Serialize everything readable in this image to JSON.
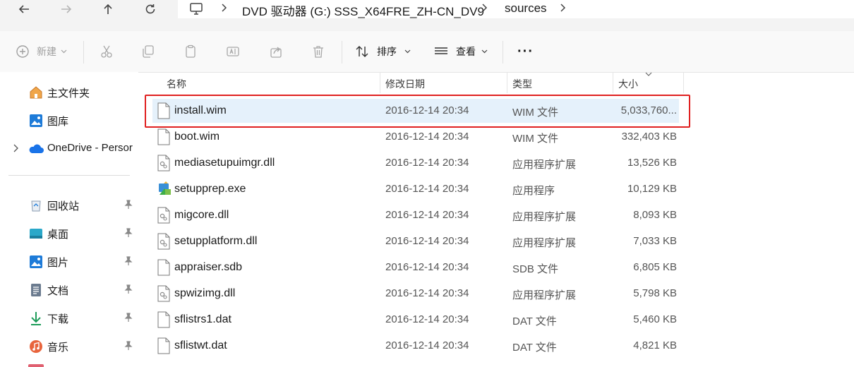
{
  "address": {
    "crumbs": [
      "DVD 驱动器 (G:) SSS_X64FRE_ZH-CN_DV9",
      "sources"
    ]
  },
  "toolbar": {
    "new_label": "新建",
    "sort_label": "排序",
    "view_label": "查看",
    "more_label": "···"
  },
  "sidebar": {
    "items": [
      {
        "label": "主文件夹"
      },
      {
        "label": "图库"
      },
      {
        "label": "OneDrive - Persor"
      },
      {
        "label": "回收站"
      },
      {
        "label": "桌面"
      },
      {
        "label": "图片"
      },
      {
        "label": "文档"
      },
      {
        "label": "下载"
      },
      {
        "label": "音乐"
      }
    ]
  },
  "columns": {
    "name": "名称",
    "date": "修改日期",
    "type": "类型",
    "size": "大小"
  },
  "files": [
    {
      "name": "install.wim",
      "date": "2016-12-14 20:34",
      "type": "WIM 文件",
      "size": "5,033,760...",
      "icon": "document-icon",
      "selected": true
    },
    {
      "name": "boot.wim",
      "date": "2016-12-14 20:34",
      "type": "WIM 文件",
      "size": "332,403 KB",
      "icon": "document-icon"
    },
    {
      "name": "mediasetupuimgr.dll",
      "date": "2016-12-14 20:34",
      "type": "应用程序扩展",
      "size": "13,526 KB",
      "icon": "dll-icon"
    },
    {
      "name": "setupprep.exe",
      "date": "2016-12-14 20:34",
      "type": "应用程序",
      "size": "10,129 KB",
      "icon": "exe-icon"
    },
    {
      "name": "migcore.dll",
      "date": "2016-12-14 20:34",
      "type": "应用程序扩展",
      "size": "8,093 KB",
      "icon": "dll-icon"
    },
    {
      "name": "setupplatform.dll",
      "date": "2016-12-14 20:34",
      "type": "应用程序扩展",
      "size": "7,033 KB",
      "icon": "dll-icon"
    },
    {
      "name": "appraiser.sdb",
      "date": "2016-12-14 20:34",
      "type": "SDB 文件",
      "size": "6,805 KB",
      "icon": "document-icon"
    },
    {
      "name": "spwizimg.dll",
      "date": "2016-12-14 20:34",
      "type": "应用程序扩展",
      "size": "5,798 KB",
      "icon": "dll-icon"
    },
    {
      "name": "sflistrs1.dat",
      "date": "2016-12-14 20:34",
      "type": "DAT 文件",
      "size": "5,460 KB",
      "icon": "document-icon"
    },
    {
      "name": "sflistwt.dat",
      "date": "2016-12-14 20:34",
      "type": "DAT 文件",
      "size": "4,821 KB",
      "icon": "document-icon"
    }
  ],
  "colors": {
    "selection": "#e5f1fb",
    "highlight_border": "#e02020",
    "accent": "#0078d4"
  }
}
